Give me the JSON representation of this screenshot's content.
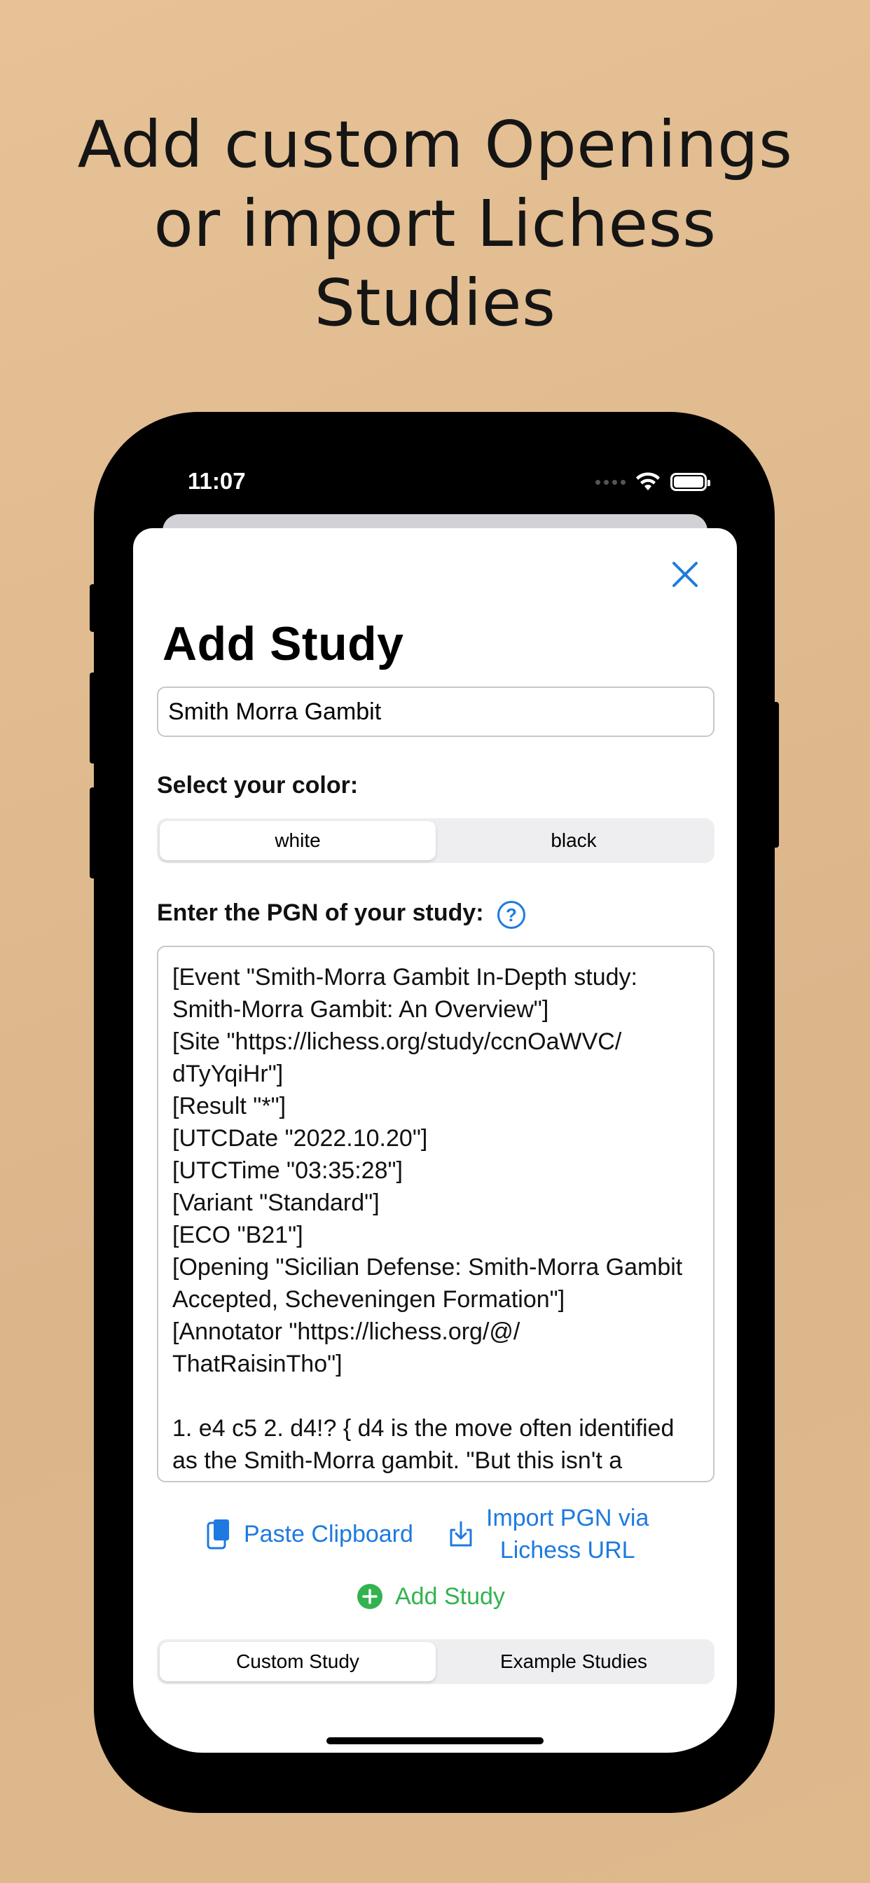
{
  "headline": {
    "lines": [
      "Add custom Openings",
      "or import Lichess",
      "Studies"
    ]
  },
  "status_bar": {
    "time": "11:07",
    "icons": [
      "signal-dots-icon",
      "wifi-icon",
      "battery-icon"
    ]
  },
  "sheet": {
    "title": "Add Study",
    "name_input": {
      "value": "Smith Morra Gambit",
      "placeholder": ""
    },
    "color_label": "Select your color:",
    "color_options": [
      "white",
      "black"
    ],
    "color_selected": "white",
    "pgn_label": "Enter the PGN of your study:",
    "pgn_text": "[Event \"Smith-Morra Gambit In-Depth study: Smith-Morra Gambit: An Overview\"]\n[Site \"https://lichess.org/study/ccnOaWVC/\ndTyYqiHr\"]\n[Result \"*\"]\n[UTCDate \"2022.10.20\"]\n[UTCTime \"03:35:28\"]\n[Variant \"Standard\"]\n[ECO \"B21\"]\n[Opening \"Sicilian Defense: Smith-Morra Gambit Accepted, Scheveningen Formation\"]\n[Annotator \"https://lichess.org/@/\nThatRaisinTho\"]\n\n1. e4 c5 2. d4!? { d4 is the move often identified as the Smith-Morra gambit. \"But this isn't a",
    "paste_label": "Paste Clipboard",
    "import_label_line1": "Import PGN via",
    "import_label_line2": "Lichess URL",
    "add_study_label": "Add Study",
    "bottom_tabs": [
      "Custom Study",
      "Example Studies"
    ],
    "bottom_selected": "Custom Study"
  },
  "colors": {
    "accent_blue": "#1e7ae0",
    "accent_green": "#32b350",
    "background": "#dcb68b"
  }
}
